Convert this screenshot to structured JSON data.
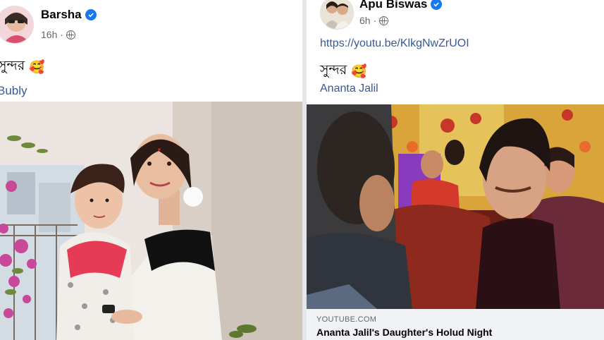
{
  "left_post": {
    "author_name": "Barsha",
    "time": "16h ·",
    "text": "সুন্দর",
    "emoji": "🥰",
    "tag": "Bubly",
    "verified": true
  },
  "right_post": {
    "author_name": "Apu Biswas",
    "time": "6h ·",
    "url": "https://youtu.be/KlkgNwZrUOI",
    "text": "সুন্দর",
    "emoji": "🥰",
    "tag": "Ananta Jalil",
    "verified": true,
    "link_preview": {
      "domain": "YOUTUBE.COM",
      "title": "Ananta Jalil's Daughter's Holud Night"
    }
  },
  "colors": {
    "verified_badge": "#1877f2",
    "link": "#385898",
    "secondary_text": "#65676b",
    "page_bg": "#e4e6eb"
  },
  "icons": [
    "verified-badge-icon",
    "globe-icon",
    "smiling-face-with-hearts-emoji"
  ]
}
